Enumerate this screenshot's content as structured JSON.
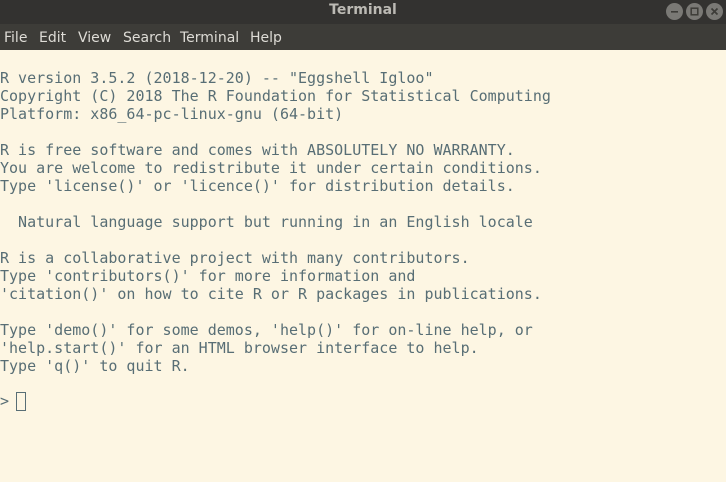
{
  "window": {
    "title": "Terminal",
    "controls": [
      "minimize-icon",
      "maximize-icon",
      "close-icon"
    ]
  },
  "menubar": {
    "items": [
      {
        "label": "File"
      },
      {
        "label": "Edit"
      },
      {
        "label": "View"
      },
      {
        "label": "Search"
      },
      {
        "label": "Terminal"
      },
      {
        "label": "Help"
      }
    ]
  },
  "terminal": {
    "lines": [
      "R version 3.5.2 (2018-12-20) -- \"Eggshell Igloo\"",
      "Copyright (C) 2018 The R Foundation for Statistical Computing",
      "Platform: x86_64-pc-linux-gnu (64-bit)",
      "R is free software and comes with ABSOLUTELY NO WARRANTY.",
      "You are welcome to redistribute it under certain conditions.",
      "Type 'license()' or 'licence()' for distribution details.",
      "  Natural language support but running in an English locale",
      "R is a collaborative project with many contributors.",
      "Type 'contributors()' for more information and",
      "'citation()' on how to cite R or R packages in publications.",
      "Type 'demo()' for some demos, 'help()' for on-line help, or",
      "'help.start()' for an HTML browser interface to help.",
      "Type 'q()' to quit R."
    ],
    "prompt": "> ",
    "input": ""
  },
  "colors": {
    "background": "#fdf6e3",
    "foreground": "#586e75",
    "titlebar": "#333230",
    "menubar": "#3d3c38"
  }
}
